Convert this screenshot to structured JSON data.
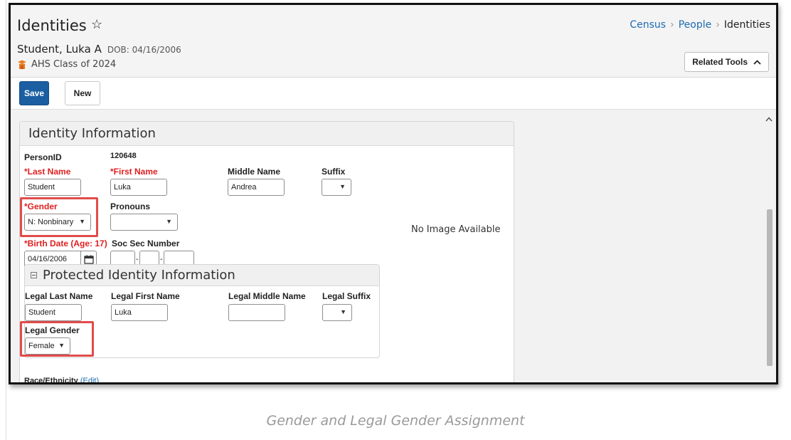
{
  "header": {
    "title": "Identities",
    "student_name": "Student, Luka A",
    "dob": "DOB: 04/16/2006",
    "school": "AHS Class of 2024",
    "related_tools_label": "Related Tools"
  },
  "breadcrumb": {
    "items": [
      "Census",
      "People",
      "Identities"
    ]
  },
  "toolbar": {
    "save_label": "Save",
    "new_label": "New"
  },
  "identity": {
    "heading": "Identity Information",
    "person_id_label": "PersonID",
    "person_id_value": "120648",
    "last_name_label": "*Last Name",
    "last_name_value": "Student",
    "first_name_label": "*First Name",
    "first_name_value": "Luka",
    "middle_name_label": "Middle Name",
    "middle_name_value": "Andrea",
    "suffix_label": "Suffix",
    "suffix_value": "",
    "gender_label": "*Gender",
    "gender_value": "N: Nonbinary",
    "pronouns_label": "Pronouns",
    "pronouns_value": "",
    "birth_date_label": "*Birth Date (Age: 17)",
    "birth_date_value": "04/16/2006",
    "ssn_label": "Soc Sec Number",
    "no_image_text": "No Image Available"
  },
  "protected": {
    "heading": "Protected Identity Information",
    "legal_last_name_label": "Legal Last Name",
    "legal_last_name_value": "Student",
    "legal_first_name_label": "Legal First Name",
    "legal_first_name_value": "Luka",
    "legal_middle_name_label": "Legal Middle Name",
    "legal_middle_name_value": "",
    "legal_suffix_label": "Legal Suffix",
    "legal_suffix_value": "",
    "legal_gender_label": "Legal Gender",
    "legal_gender_value": "Female"
  },
  "race": {
    "label": "Race/Ethnicity",
    "edit_label": "(Edit)"
  },
  "caption": "Gender and Legal Gender Assignment",
  "colors": {
    "primary_button": "#1b5ea1",
    "required_label": "#e02020",
    "highlight": "#e24b4b",
    "link": "#1c6cb0"
  }
}
